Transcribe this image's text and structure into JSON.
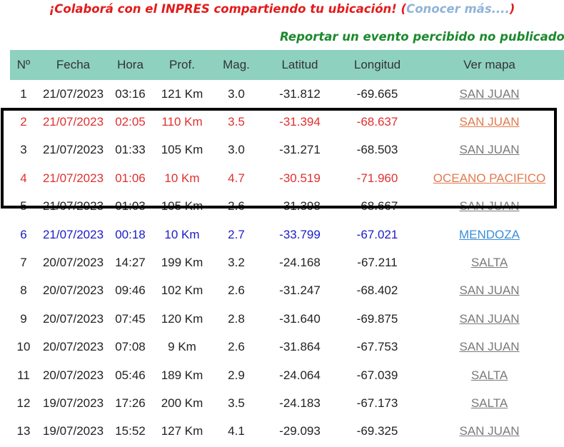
{
  "banner": {
    "text": "¡Colaborá con el INPRES compartiendo tu ubicación! (",
    "learn_more": "Conocer más....",
    "close_paren": ")"
  },
  "report_link": "Reportar un evento percibido no publicado",
  "table": {
    "headers": [
      "Nº",
      "Fecha",
      "Hora",
      "Prof.",
      "Mag.",
      "Latitud",
      "Longitud",
      "Ver mapa"
    ],
    "rows": [
      {
        "n": "1",
        "fecha": "21/07/2023",
        "hora": "03:16",
        "prof": "121 Km",
        "mag": "3.0",
        "lat": "-31.812",
        "lon": "-69.665",
        "mapa": "SAN JUAN",
        "color": "normal"
      },
      {
        "n": "2",
        "fecha": "21/07/2023",
        "hora": "02:05",
        "prof": "110 Km",
        "mag": "3.5",
        "lat": "-31.394",
        "lon": "-68.637",
        "mapa": "SAN JUAN",
        "color": "red"
      },
      {
        "n": "3",
        "fecha": "21/07/2023",
        "hora": "01:33",
        "prof": "105 Km",
        "mag": "3.0",
        "lat": "-31.271",
        "lon": "-68.503",
        "mapa": "SAN JUAN",
        "color": "normal"
      },
      {
        "n": "4",
        "fecha": "21/07/2023",
        "hora": "01:06",
        "prof": "10 Km",
        "mag": "4.7",
        "lat": "-30.519",
        "lon": "-71.960",
        "mapa": "OCEANO PACIFICO",
        "color": "red"
      },
      {
        "n": "5",
        "fecha": "21/07/2023",
        "hora": "01:03",
        "prof": "105 Km",
        "mag": "2.6",
        "lat": "-31.398",
        "lon": "-68.667",
        "mapa": "SAN JUAN",
        "color": "normal"
      },
      {
        "n": "6",
        "fecha": "21/07/2023",
        "hora": "00:18",
        "prof": "10 Km",
        "mag": "2.7",
        "lat": "-33.799",
        "lon": "-67.021",
        "mapa": "MENDOZA",
        "color": "blue"
      },
      {
        "n": "7",
        "fecha": "20/07/2023",
        "hora": "14:27",
        "prof": "199 Km",
        "mag": "3.2",
        "lat": "-24.168",
        "lon": "-67.211",
        "mapa": "SALTA",
        "color": "normal"
      },
      {
        "n": "8",
        "fecha": "20/07/2023",
        "hora": "09:46",
        "prof": "102 Km",
        "mag": "2.6",
        "lat": "-31.247",
        "lon": "-68.402",
        "mapa": "SAN JUAN",
        "color": "normal"
      },
      {
        "n": "9",
        "fecha": "20/07/2023",
        "hora": "07:45",
        "prof": "120 Km",
        "mag": "2.8",
        "lat": "-31.640",
        "lon": "-69.875",
        "mapa": "SAN JUAN",
        "color": "normal"
      },
      {
        "n": "10",
        "fecha": "20/07/2023",
        "hora": "07:08",
        "prof": "9 Km",
        "mag": "2.6",
        "lat": "-31.864",
        "lon": "-67.753",
        "mapa": "SAN JUAN",
        "color": "normal"
      },
      {
        "n": "11",
        "fecha": "20/07/2023",
        "hora": "05:46",
        "prof": "189 Km",
        "mag": "2.9",
        "lat": "-24.064",
        "lon": "-67.039",
        "mapa": "SALTA",
        "color": "normal"
      },
      {
        "n": "12",
        "fecha": "19/07/2023",
        "hora": "17:26",
        "prof": "200 Km",
        "mag": "3.5",
        "lat": "-24.183",
        "lon": "-67.173",
        "mapa": "SALTA",
        "color": "normal"
      },
      {
        "n": "13",
        "fecha": "19/07/2023",
        "hora": "15:52",
        "prof": "127 Km",
        "mag": "4.1",
        "lat": "-29.093",
        "lon": "-69.325",
        "mapa": "SAN JUAN",
        "color": "normal"
      }
    ]
  },
  "colors": {
    "header_bg": "#8ed1bf",
    "banner_red": "#e31b1b",
    "report_green": "#1b8a2c",
    "highlight_red": "#e03030",
    "highlight_blue": "#1c1cc8"
  }
}
